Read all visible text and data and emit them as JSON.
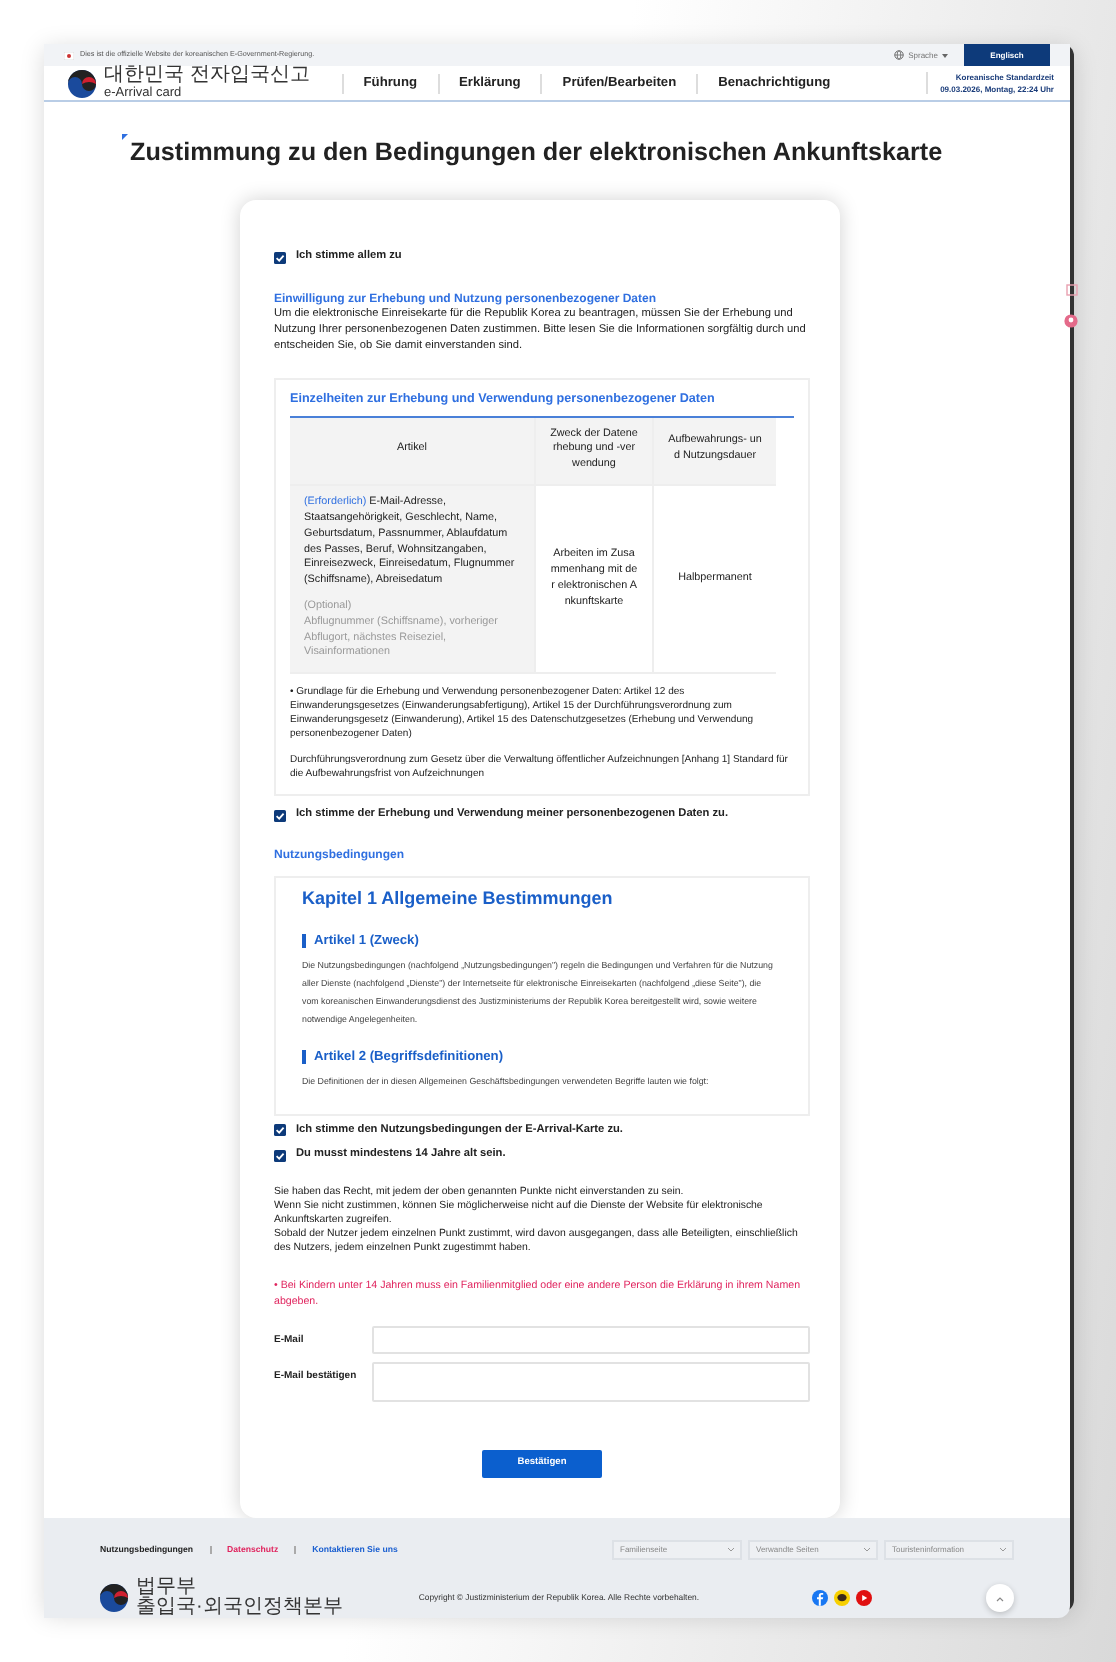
{
  "top_bar": {
    "notice": "Dies ist die offizielle Website der koreanischen E-Government-Regierung.",
    "language_label": "Sprache",
    "language_button": "Englisch"
  },
  "header": {
    "logo_title": "대한민국 전자입국신고",
    "logo_subtitle": "e-Arrival card",
    "menu": [
      "Führung",
      "Erklärung",
      "Prüfen/Bearbeiten",
      "Benachrichtigung"
    ],
    "time_label": "Koreanische Standardzeit",
    "time_value": "09.03.2026, Montag, 22:24 Uhr"
  },
  "page_title": "Zustimmung zu den Bedingungen der elektronischen Ankunftskarte",
  "agree_all": {
    "label": "Ich stimme allem zu",
    "checked": true
  },
  "privacy": {
    "heading": "Einwilligung zur Erhebung und Nutzung personenbezogener Daten",
    "intro": "Um die elektronische Einreisekarte für die Republik Korea zu beantragen, müssen Sie der Erhebung und Nutzung Ihrer personenbezogenen Daten zustimmen. Bitte lesen Sie die Informationen sorgfältig durch und entscheiden Sie, ob Sie damit einverstanden sind.",
    "table_title": "Einzelheiten zur Erhebung und Verwendung personenbezogener Daten",
    "columns": [
      "Artikel",
      "Zweck der Datenerhebung und -verwendung",
      "Aufbewahrungs- und Nutzungsdauer"
    ],
    "row": {
      "required_label": "(Erforderlich)",
      "required_items": "E-Mail-Adresse, Staatsangehörigkeit, Geschlecht, Name, Geburtsdatum, Passnummer, Ablaufdatum des Passes, Beruf, Wohnsitzangaben, Einreisezweck, Einreisedatum, Flugnummer (Schiffsname), Abreisedatum",
      "optional_label": "(Optional)",
      "optional_items": "Abflugnummer (Schiffsname), vorheriger Abflugort, nächstes Reiseziel, Visainformationen",
      "purpose": "Arbeiten im Zusammenhang mit der elektronischen Ankunftskarte",
      "period": "Halbpermanent"
    },
    "notes": [
      "• Grundlage für die Erhebung und Verwendung personenbezogener Daten: Artikel 12 des Einwanderungsgesetzes (Einwanderungsabfertigung), Artikel 15 der Durchführungsverordnung zum Einwanderungsgesetz (Einwanderung), Artikel 15 des Datenschutzgesetzes (Erhebung und Verwendung personenbezogener Daten)",
      "Durchführungsverordnung zum Gesetz über die Verwaltung öffentlicher Aufzeichnungen [Anhang 1] Standard für die Aufbewahrungsfrist von Aufzeichnungen"
    ],
    "consent": {
      "label": "Ich stimme der Erhebung und Verwendung meiner personenbezogenen Daten zu.",
      "checked": true
    }
  },
  "terms": {
    "heading": "Nutzungsbedingungen",
    "chapter": "Kapitel 1 Allgemeine Bestimmungen",
    "articles": [
      {
        "title": "Artikel 1 (Zweck)",
        "text": "Die Nutzungsbedingungen (nachfolgend „Nutzungsbedingungen\") regeln die Bedingungen und Verfahren für die Nutzung aller Dienste (nachfolgend „Dienste\") der Internetseite für elektronische Einreisekarten (nachfolgend „diese Seite\"), die vom koreanischen Einwanderungsdienst des Justizministeriums der Republik Korea bereitgestellt wird, sowie weitere notwendige Angelegenheiten."
      },
      {
        "title": "Artikel 2 (Begriffsdefinitionen)",
        "text": "Die Definitionen der in diesen Allgemeinen Geschäftsbedingungen verwendeten Begriffe lauten wie folgt:"
      }
    ]
  },
  "consents": [
    {
      "label": "Ich stimme den Nutzungsbedingungen der E-Arrival-Karte zu.",
      "checked": true
    },
    {
      "label": "Du musst mindestens 14 Jahre alt sein.",
      "checked": true
    }
  ],
  "rights_lines": [
    "Sie haben das Recht, mit jedem der oben genannten Punkte nicht einverstanden zu sein.",
    "Wenn Sie nicht zustimmen, können Sie möglicherweise nicht auf die Dienste der Website für elektronische Ankunftskarten zugreifen.",
    "Sobald der Nutzer jedem einzelnen Punkt zustimmt, wird davon ausgegangen, dass alle Beteiligten, einschließlich des Nutzers, jedem einzelnen Punkt zugestimmt haben."
  ],
  "child_notice": "• Bei Kindern unter 14 Jahren muss ein Familienmitglied oder eine andere Person die Erklärung in ihrem Namen abgeben.",
  "fields": [
    {
      "label": "E-Mail"
    },
    {
      "label": "E-Mail bestätigen"
    }
  ],
  "submit": "Bestätigen",
  "footer": {
    "links": [
      {
        "label": "Nutzungsbedingungen",
        "color": "#222222"
      },
      {
        "label": "Datenschutz",
        "color": "#e0245e"
      },
      {
        "label": "Kontaktieren Sie uns",
        "color": "#1a5fd0"
      }
    ],
    "selects": [
      "Familienseite",
      "Verwandte Seiten",
      "Touristeninformation"
    ],
    "org_small": "법무부",
    "org_name": "출입국·외국인정책본부",
    "copyright": "Copyright © Justizministerium der Republik Korea. Alle Rechte vorbehalten."
  }
}
